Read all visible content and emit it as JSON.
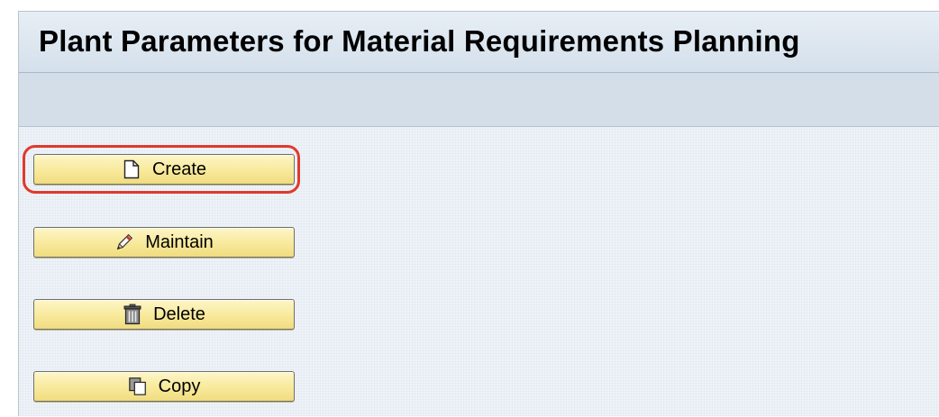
{
  "window": {
    "title": "Plant Parameters for Material Requirements Planning"
  },
  "buttons": [
    {
      "id": "create",
      "label": "Create",
      "icon": "new-document-icon",
      "highlighted": true
    },
    {
      "id": "maintain",
      "label": "Maintain",
      "icon": "pencil-icon",
      "highlighted": false
    },
    {
      "id": "delete",
      "label": "Delete",
      "icon": "trash-icon",
      "highlighted": false
    },
    {
      "id": "copy",
      "label": "Copy",
      "icon": "copy-icon",
      "highlighted": false
    }
  ],
  "colors": {
    "highlight": "#e03a2c",
    "button_fill": "#f8e99a",
    "background": "#eef3f8",
    "toolbar": "#d3dee8"
  }
}
